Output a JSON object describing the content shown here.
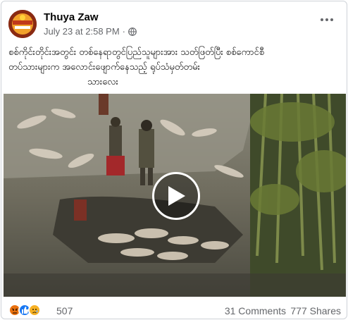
{
  "post": {
    "author": "Thuya Zaw",
    "timestamp": "July 23 at 2:58 PM",
    "separator": "·",
    "privacy_icon": "globe-icon",
    "more_icon": "more-options-icon",
    "caption_lines": [
      "စစ်ကိုင်းတိုင်းအတွင်း တစ်နေရာတွင်ပြည်သူများအား သတ်ဖြတ်ပြီး စစ်ကောင်စီ",
      "တပ်သားများက အလောင်းဖျောက်နေသည့် ရုပ်သံမှတ်တမ်း",
      "သားလေး"
    ]
  },
  "video": {
    "play_icon": "play-icon"
  },
  "footer": {
    "reaction_icons": [
      "angry-reaction-icon",
      "like-reaction-icon",
      "sad-reaction-icon"
    ],
    "reaction_count": "507",
    "comments": "31 Comments",
    "shares": "777 Shares"
  },
  "colors": {
    "meta_text": "#65676b",
    "like_blue": "#1877f2",
    "angry_orange": "#e9710f",
    "sad_yellow": "#f7b125"
  }
}
